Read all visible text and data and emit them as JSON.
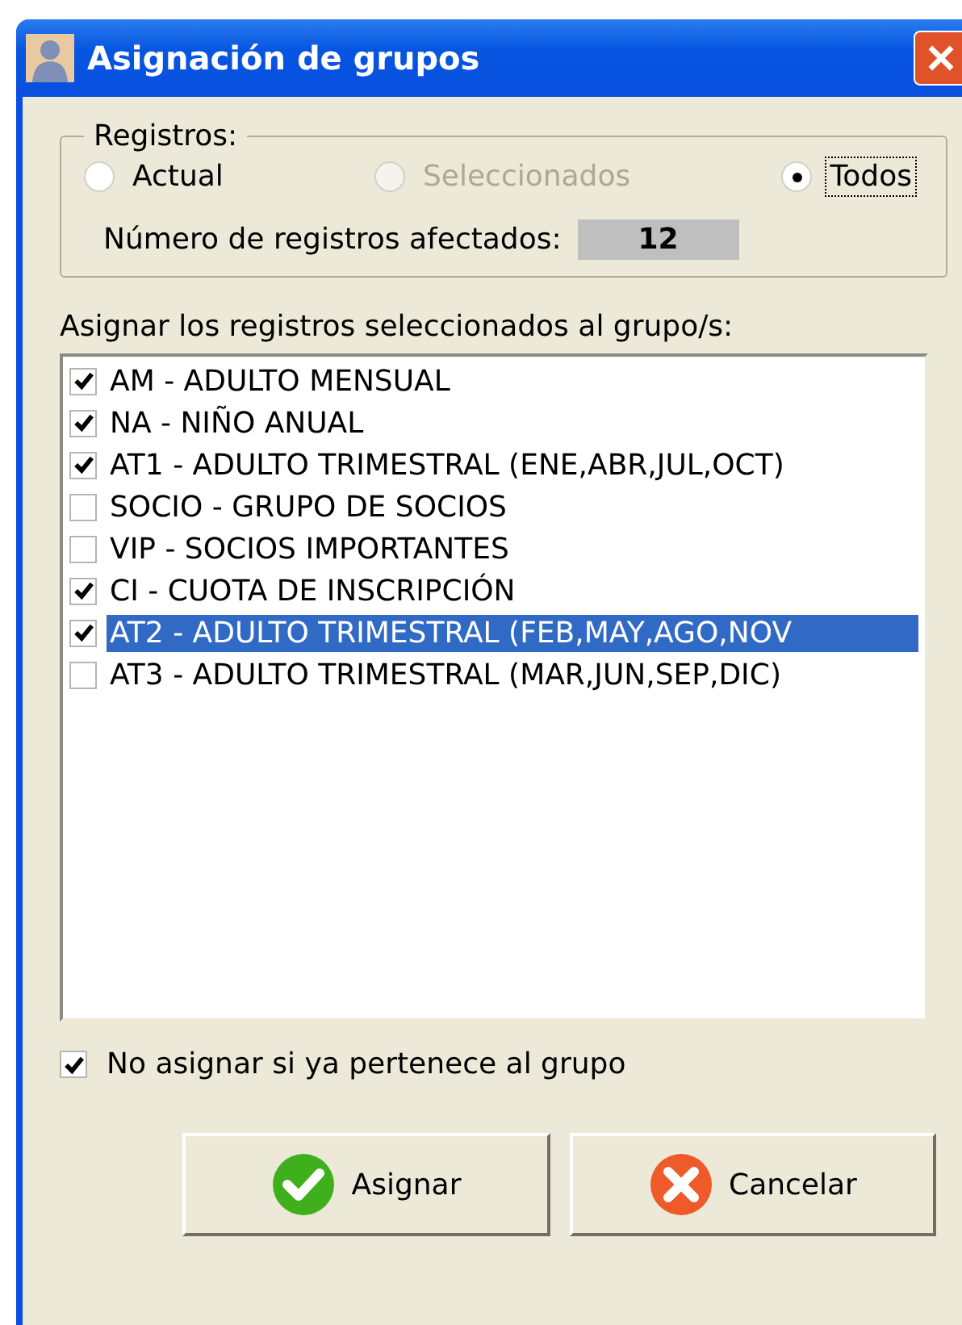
{
  "window": {
    "title": "Asignación de grupos"
  },
  "registros": {
    "legend": "Registros:",
    "options": [
      {
        "label": "Actual",
        "selected": false,
        "disabled": false,
        "focused": false
      },
      {
        "label": "Seleccionados",
        "selected": false,
        "disabled": true,
        "focused": false
      },
      {
        "label": "Todos",
        "selected": true,
        "disabled": false,
        "focused": true
      }
    ],
    "count_label": "Número de registros afectados:",
    "count_value": "12"
  },
  "groups_label": "Asignar los registros seleccionados al grupo/s:",
  "groups": [
    {
      "label": "AM - ADULTO MENSUAL",
      "checked": true,
      "selected": false
    },
    {
      "label": "NA - NIÑO ANUAL",
      "checked": true,
      "selected": false
    },
    {
      "label": "AT1 - ADULTO TRIMESTRAL (ENE,ABR,JUL,OCT)",
      "checked": true,
      "selected": false
    },
    {
      "label": "SOCIO - GRUPO DE SOCIOS",
      "checked": false,
      "selected": false
    },
    {
      "label": "VIP - SOCIOS IMPORTANTES",
      "checked": false,
      "selected": false
    },
    {
      "label": "CI - CUOTA DE INSCRIPCIÓN",
      "checked": true,
      "selected": false
    },
    {
      "label": "AT2 - ADULTO TRIMESTRAL (FEB,MAY,AGO,NOV",
      "checked": true,
      "selected": true
    },
    {
      "label": "AT3 - ADULTO TRIMESTRAL (MAR,JUN,SEP,DIC)",
      "checked": false,
      "selected": false
    }
  ],
  "no_assign": {
    "label": "No asignar si ya pertenece al grupo",
    "checked": true
  },
  "buttons": [
    {
      "label": "Asignar",
      "kind": "ok"
    },
    {
      "label": "Cancelar",
      "kind": "cancel"
    }
  ]
}
